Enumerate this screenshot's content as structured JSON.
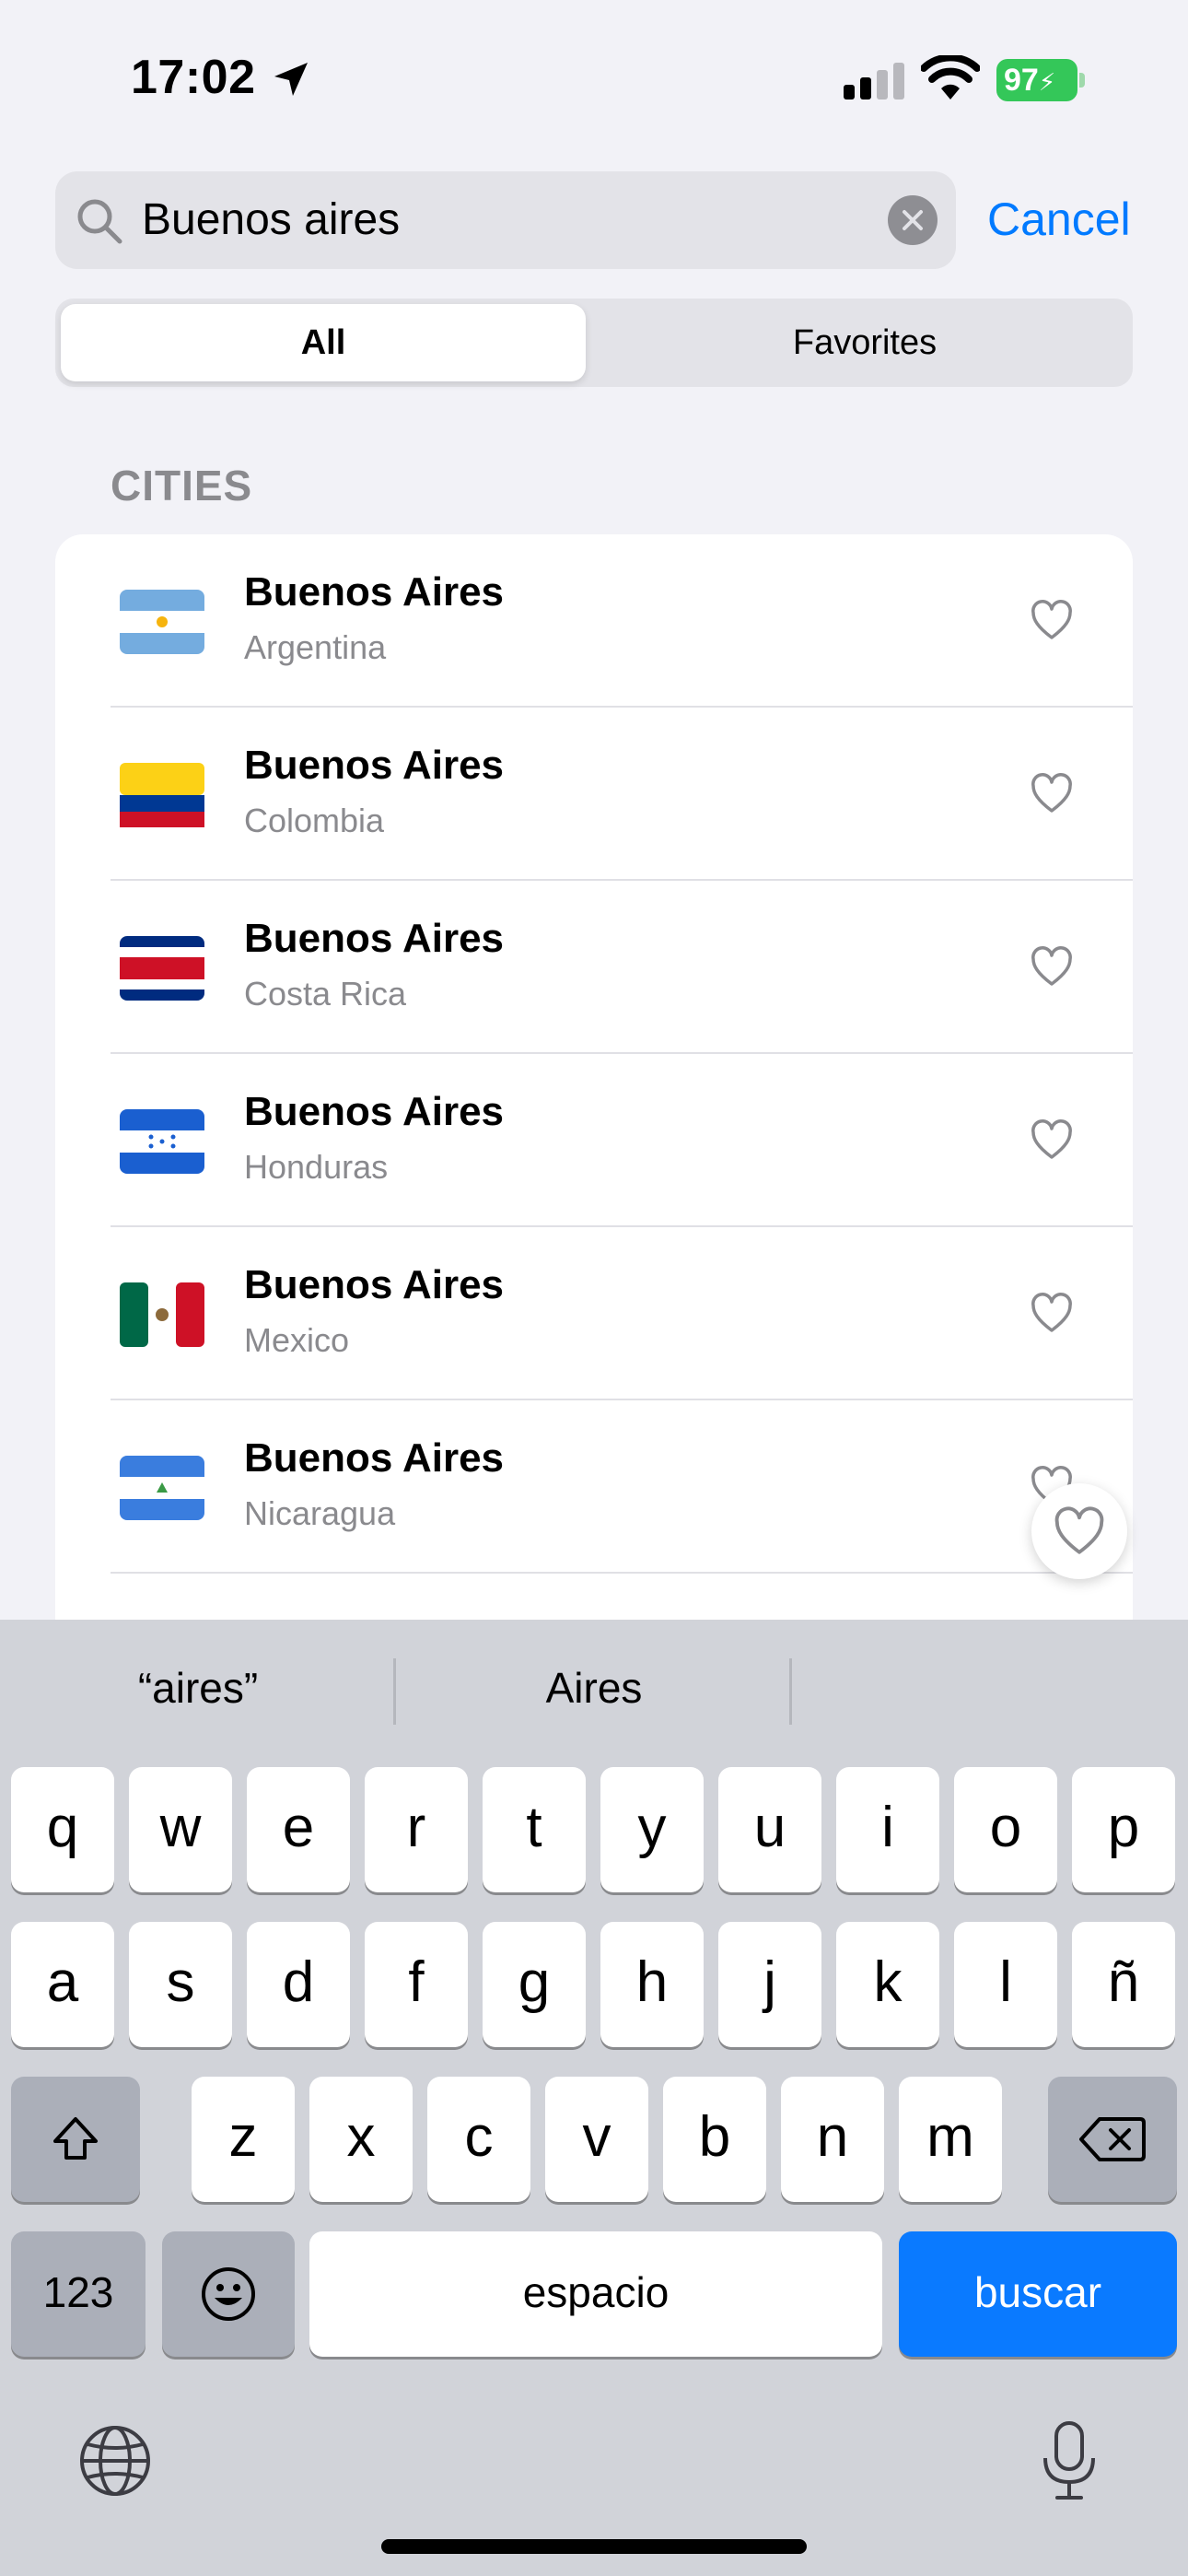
{
  "status_bar": {
    "time": "17:02",
    "battery_level": "97"
  },
  "search": {
    "query": "Buenos aires",
    "cancel_label": "Cancel"
  },
  "segments": {
    "all": "All",
    "favorites": "Favorites",
    "selected": "All"
  },
  "section_title": "CITIES",
  "results": [
    {
      "city": "Buenos Aires",
      "country": "Argentina",
      "flag": "argentina-flag-icon"
    },
    {
      "city": "Buenos Aires",
      "country": "Colombia",
      "flag": "colombia-flag-icon"
    },
    {
      "city": "Buenos Aires",
      "country": "Costa Rica",
      "flag": "costa-rica-flag-icon"
    },
    {
      "city": "Buenos Aires",
      "country": "Honduras",
      "flag": "honduras-flag-icon"
    },
    {
      "city": "Buenos Aires",
      "country": "Mexico",
      "flag": "mexico-flag-icon"
    },
    {
      "city": "Buenos Aires",
      "country": "Nicaragua",
      "flag": "nicaragua-flag-icon"
    }
  ],
  "keyboard": {
    "suggestions": [
      "“aires”",
      "Aires"
    ],
    "row1": [
      "q",
      "w",
      "e",
      "r",
      "t",
      "y",
      "u",
      "i",
      "o",
      "p"
    ],
    "row2": [
      "a",
      "s",
      "d",
      "f",
      "g",
      "h",
      "j",
      "k",
      "l",
      "ñ"
    ],
    "row3": [
      "z",
      "x",
      "c",
      "v",
      "b",
      "n",
      "m"
    ],
    "numbers_label": "123",
    "space_label": "espacio",
    "return_label": "buscar"
  },
  "colors": {
    "accent": "#007aff",
    "battery": "#34c759",
    "return_key": "#0a7aff"
  }
}
